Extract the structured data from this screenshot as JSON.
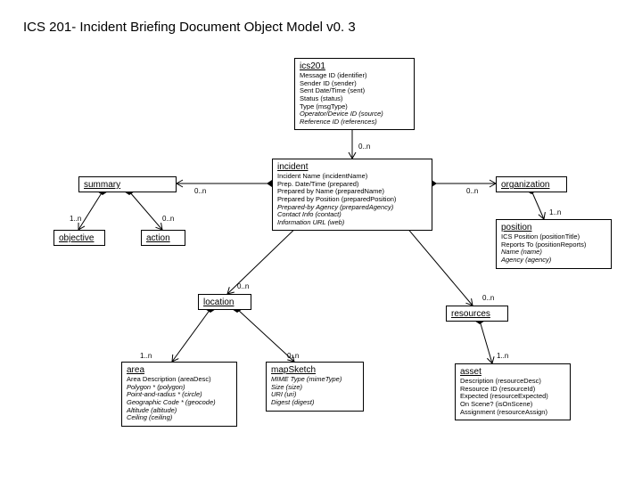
{
  "title": "ICS 201- Incident Briefing Document Object Model v0. 3",
  "boxes": {
    "ics201": {
      "name": "ics201",
      "attrs": [
        "Message ID (identifier)",
        "Sender ID (sender)",
        "Sent Date/Time (sent)",
        "Status (status)",
        "Type (msgType)"
      ],
      "attrs_italic": [
        "Operator/Device ID (source)",
        "Reference ID (references)"
      ]
    },
    "incident": {
      "name": "incident",
      "attrs": [
        "Incident Name (incidentName)",
        "Prep. Date/Time (prepared)",
        "Prepared by Name (preparedName)",
        "Prepared by Position (preparedPosition)"
      ],
      "attrs_italic": [
        "Prepared-by Agency (preparedAgency)",
        "Contact Info (contact)",
        "Information URL (web)"
      ]
    },
    "summary": {
      "name": "summary"
    },
    "objective": {
      "name": "objective"
    },
    "action": {
      "name": "action"
    },
    "organization": {
      "name": "organization"
    },
    "position": {
      "name": "position",
      "attrs": [
        "ICS Position (positionTitle)",
        "Reports To (positionReports)"
      ],
      "attrs_italic": [
        "Name (name)",
        "Agency (agency)"
      ]
    },
    "location": {
      "name": "location"
    },
    "resources": {
      "name": "resources"
    },
    "area": {
      "name": "area",
      "attrs": [
        "Area Description (areaDesc)"
      ],
      "attrs_italic": [
        "Polygon * (polygon)",
        "Point-and-radius * (circle)",
        "Geographic Code * (geocode)",
        "Altitude (altitude)",
        "Ceiling (ceiling)"
      ]
    },
    "mapSketch": {
      "name": "mapSketch",
      "attrs_italic": [
        "MIME Type (mimeType)",
        "Size (size)",
        "URI (uri)",
        "Digest (digest)"
      ]
    },
    "asset": {
      "name": "asset",
      "attrs": [
        "Description (resourceDesc)",
        "Resource ID (resourceId)",
        "Expected (resourceExpected)",
        "On Scene? (isOnScene)",
        "Assignment (resourceAssign)"
      ]
    }
  },
  "mult": {
    "incident_to_ics201": "0..n",
    "summary_to_incident": "0..n",
    "objective_to_summary": "1..n",
    "action_to_summary": "0..n",
    "organization_to_incident": "0..n",
    "position_to_organization": "1..n",
    "location_to_incident": "0..n",
    "resources_to_incident": "0..n",
    "area_to_location": "1..n",
    "mapSketch_to_location": "0..n",
    "asset_to_resources": "1..n"
  }
}
